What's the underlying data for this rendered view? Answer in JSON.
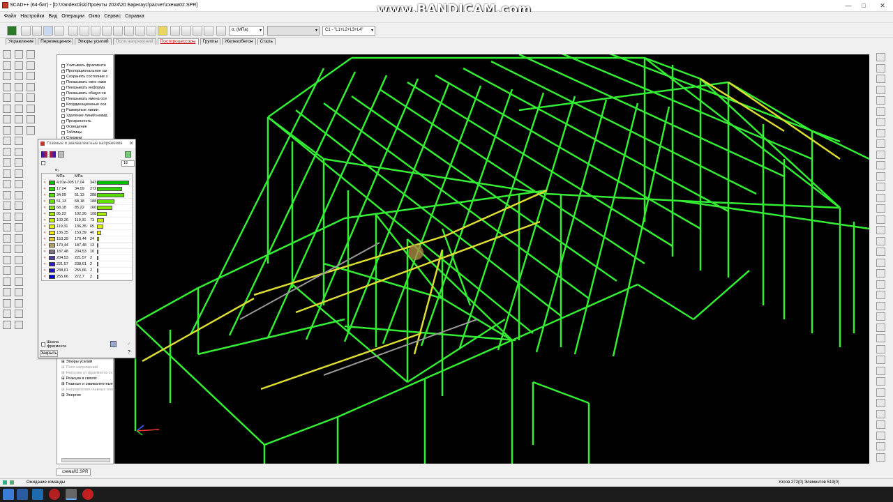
{
  "window": {
    "title": "SCAD++ (64-бит) - [D:\\YandexDisk\\Проекты 2024\\20 Барнгаус\\расчет\\схема02.SPR]",
    "watermark": "www.BANDICAM.com",
    "controls": [
      "—",
      "□",
      "✕"
    ]
  },
  "menu": [
    "Файл",
    "Настройки",
    "Вид",
    "Операции",
    "Окно",
    "Сервис",
    "Справка"
  ],
  "toolbar": {
    "stress_combo": "σ, (МПа)",
    "load_combo": "",
    "combination_combo": "C1 - \"L1+L2+L3+L4\""
  },
  "tabs": [
    {
      "label": "Управление",
      "state": "normal"
    },
    {
      "label": "Перемещения",
      "state": "normal"
    },
    {
      "label": "Эпюры усилий",
      "state": "normal"
    },
    {
      "label": "Поля напряжений",
      "state": "disabled"
    },
    {
      "label": "Постпроцессоры",
      "state": "active"
    },
    {
      "label": "Группы",
      "state": "normal"
    },
    {
      "label": "Железобетон",
      "state": "normal"
    },
    {
      "label": "Сталь",
      "state": "normal"
    }
  ],
  "tree": {
    "top_items": [
      {
        "label": "Учитывать фрагмента",
        "checked": false
      },
      {
        "label": "Пропорциональное заг",
        "checked": true
      },
      {
        "label": "Сохранять состояние з",
        "checked": false
      },
      {
        "label": "Показывать окно нави",
        "checked": false
      },
      {
        "label": "Показывать информа",
        "checked": false
      },
      {
        "label": "Показывать общую си",
        "checked": false
      },
      {
        "label": "Показывать имена осе",
        "checked": true
      },
      {
        "label": "Координационные оси",
        "checked": false
      },
      {
        "label": "Размерные линии",
        "checked": false
      },
      {
        "label": "Удаление линий невид",
        "checked": false
      },
      {
        "label": "Прозрачность",
        "checked": false
      },
      {
        "label": "Освещение",
        "checked": false
      },
      {
        "label": "Таблицы",
        "checked": false
      },
      {
        "label": "Стержни",
        "checked": false
      }
    ],
    "bottom_items": [
      "Эпюры усилий",
      "Поля напряжений",
      "Нагрузки от фрагмента сх",
      "Реакции в связях",
      "Главные и эквивалентные",
      "Направления главных пло",
      "Энергия"
    ]
  },
  "dialog": {
    "title": "Главные и эквивалентные напряжения",
    "levels": "16",
    "symbol": "σ₁",
    "col1": "МПа",
    "col2": "МПа",
    "rows": [
      {
        "from": "4,01e-005",
        "to": "17,04",
        "count": "343",
        "color": "#00c000",
        "share": 1.0
      },
      {
        "from": "17,04",
        "to": "34,09",
        "count": "272",
        "color": "#33d400",
        "share": 0.79
      },
      {
        "from": "34,09",
        "to": "51,13",
        "count": "288",
        "color": "#55dd00",
        "share": 0.84
      },
      {
        "from": "51,13",
        "to": "68,18",
        "count": "188",
        "color": "#66e000",
        "share": 0.55
      },
      {
        "from": "68,18",
        "to": "85,22",
        "count": "160",
        "color": "#88e600",
        "share": 0.47
      },
      {
        "from": "85,22",
        "to": "102,26",
        "count": "108",
        "color": "#a6ec00",
        "share": 0.31
      },
      {
        "from": "102,26",
        "to": "119,31",
        "count": "73",
        "color": "#c2f000",
        "share": 0.21
      },
      {
        "from": "119,31",
        "to": "136,35",
        "count": "65",
        "color": "#dff300",
        "share": 0.19
      },
      {
        "from": "136,35",
        "to": "153,39",
        "count": "40",
        "color": "#f2f200",
        "share": 0.12
      },
      {
        "from": "153,39",
        "to": "170,44",
        "count": "24",
        "color": "#e0d040",
        "share": 0.07
      },
      {
        "from": "170,44",
        "to": "187,48",
        "count": "13",
        "color": "#b0a060",
        "share": 0.04
      },
      {
        "from": "187,48",
        "to": "204,53",
        "count": "10",
        "color": "#807080",
        "share": 0.03
      },
      {
        "from": "204,53",
        "to": "221,57",
        "count": "2",
        "color": "#5040a0",
        "share": 0.006
      },
      {
        "from": "221,57",
        "to": "238,61",
        "count": "2",
        "color": "#3020c0",
        "share": 0.006
      },
      {
        "from": "238,61",
        "to": "255,66",
        "count": "2",
        "color": "#2010d0",
        "share": 0.006
      },
      {
        "from": "255,66",
        "to": "272,7",
        "count": "2",
        "color": "#0000e0",
        "share": 0.006
      }
    ],
    "scale_label": "Шкала фрагмента",
    "close_label": "Закрыть"
  },
  "viewport": {
    "frame_color": "#33ee33",
    "high_color": "#dddd33",
    "cursor_highlight": "#aa8844"
  },
  "doc_tab": "схема02.SPR",
  "status": {
    "left": "Ожидание команды",
    "right": "Узлов 272(0) Элементов 519(0)"
  }
}
